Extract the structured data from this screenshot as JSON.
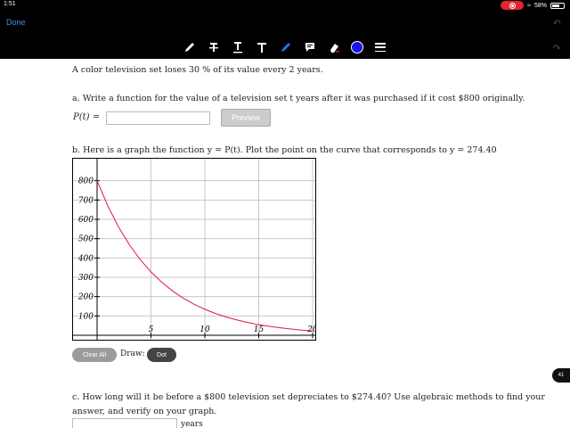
{
  "status": {
    "time": "1:51",
    "battery": "58%"
  },
  "header": {
    "done_label": "Done"
  },
  "toolbar": {
    "tools": [
      "pen-tool",
      "text-strike",
      "text-underline",
      "text",
      "highlighter",
      "comment",
      "eraser",
      "color",
      "menu"
    ],
    "color": "#1a14e8"
  },
  "problem": {
    "intro": "A color television set loses 30 %  of its value every 2 years.",
    "part_a": "a. Write a function for the value of a television set t years after it was purchased if it cost $800 originally.",
    "pt_label": "P(t) =",
    "answer_value": "",
    "preview_label": "Preview",
    "part_b": "b. Here is a graph the function y = P(t). Plot the point on the curve that corresponds to y = 274.40",
    "clear_label": "Clear All",
    "draw_label": "Draw:",
    "dot_label": "Dot",
    "part_c_line1": "c. How long will it be before a $800 television set depreciates to $274.40? Use algebraic methods to find your",
    "part_c_line2": "answer, and verify on your graph.",
    "years_value": "",
    "years_label": "years"
  },
  "page_badge": "41",
  "chart_data": {
    "type": "line",
    "title": "",
    "xlabel": "",
    "ylabel": "",
    "xlim": [
      0,
      20
    ],
    "ylim": [
      0,
      900
    ],
    "x_ticks": [
      5,
      10,
      15,
      20
    ],
    "x_tick_labels": [
      "5",
      "10",
      "15",
      "20"
    ],
    "y_ticks": [
      100,
      200,
      300,
      400,
      500,
      600,
      700,
      800
    ],
    "y_tick_labels": [
      "100",
      "200",
      "300",
      "400",
      "500",
      "600",
      "700",
      "800"
    ],
    "grid": true,
    "curve_color": "#e0193c",
    "series": [
      {
        "x": [
          0,
          1,
          2,
          3,
          4,
          5,
          6,
          7,
          8,
          9,
          10,
          11,
          12,
          13,
          14,
          15,
          16,
          17,
          18,
          19,
          20
        ],
        "y": [
          800,
          669.3,
          560,
          468.5,
          392,
          328,
          274.4,
          229.6,
          192.1,
          160.7,
          134.5,
          112.5,
          94.1,
          78.7,
          65.9,
          55.1,
          46.1,
          38.6,
          32.3,
          27,
          22.6
        ]
      }
    ]
  }
}
